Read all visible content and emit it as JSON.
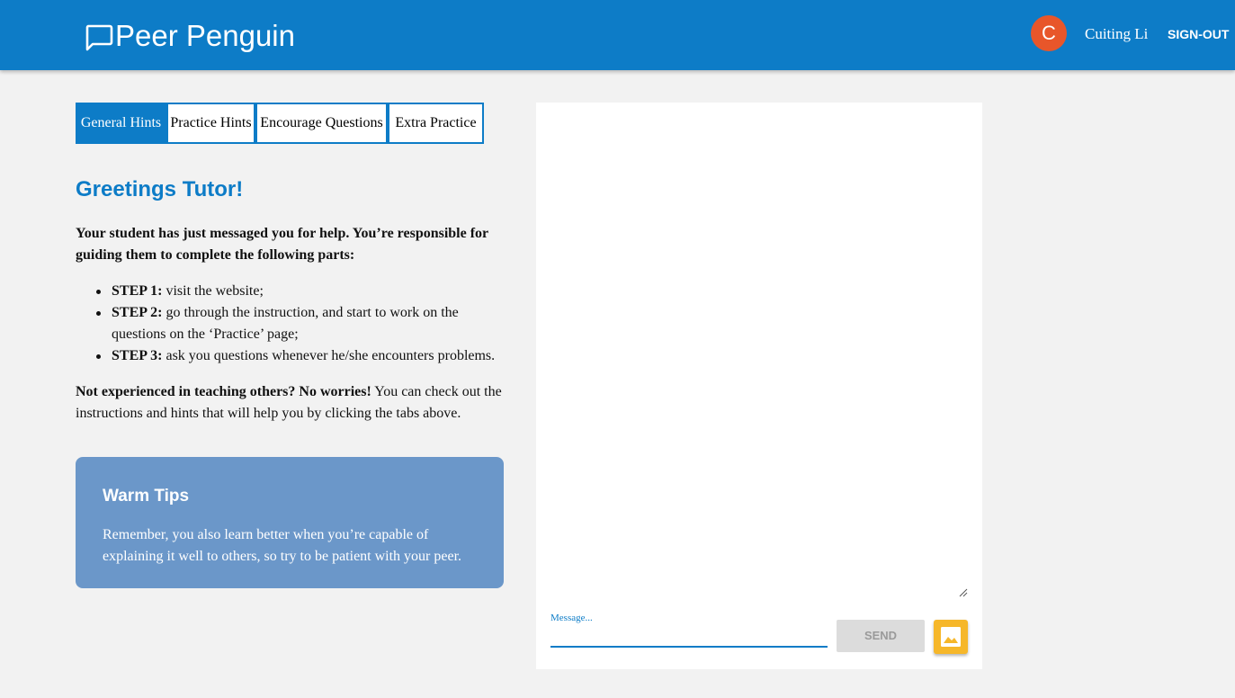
{
  "header": {
    "app_title": "Peer Penguin",
    "avatar_initial": "C",
    "user_name": "Cuiting Li",
    "signout_label": "SIGN-OUT"
  },
  "tabs": [
    {
      "label": "General Hints",
      "active": true
    },
    {
      "label": "Practice Hints",
      "active": false
    },
    {
      "label": "Encourage Questions",
      "active": false
    },
    {
      "label": "Extra Practice",
      "active": false
    }
  ],
  "content": {
    "greeting": "Greetings Tutor!",
    "intro": "Your student has just messaged you for help. You’re responsible for guiding them to complete the following parts:",
    "steps": [
      {
        "label": "STEP 1:",
        "text": " visit the website;"
      },
      {
        "label": "STEP 2:",
        "text": " go through the instruction, and start to work on the questions on the ‘Practice’ page;"
      },
      {
        "label": "STEP 3:",
        "text": " ask you questions whenever he/she encounters problems."
      }
    ],
    "outro_bold": "Not experienced in teaching others? No worries!",
    "outro_text": " You can check out the instructions and hints that will help you by clicking the tabs above."
  },
  "tips": {
    "title": "Warm Tips",
    "text": "Remember, you also learn better when you’re capable of explaining it well to others, so try to be patient with your peer."
  },
  "chat": {
    "message_label": "Message...",
    "message_value": "",
    "send_label": "SEND",
    "image_icon": "image-icon"
  },
  "colors": {
    "primary": "#0d7cc7",
    "avatar": "#e8562a",
    "tips_bg": "#6b97c9",
    "image_button": "#f6b72a"
  }
}
